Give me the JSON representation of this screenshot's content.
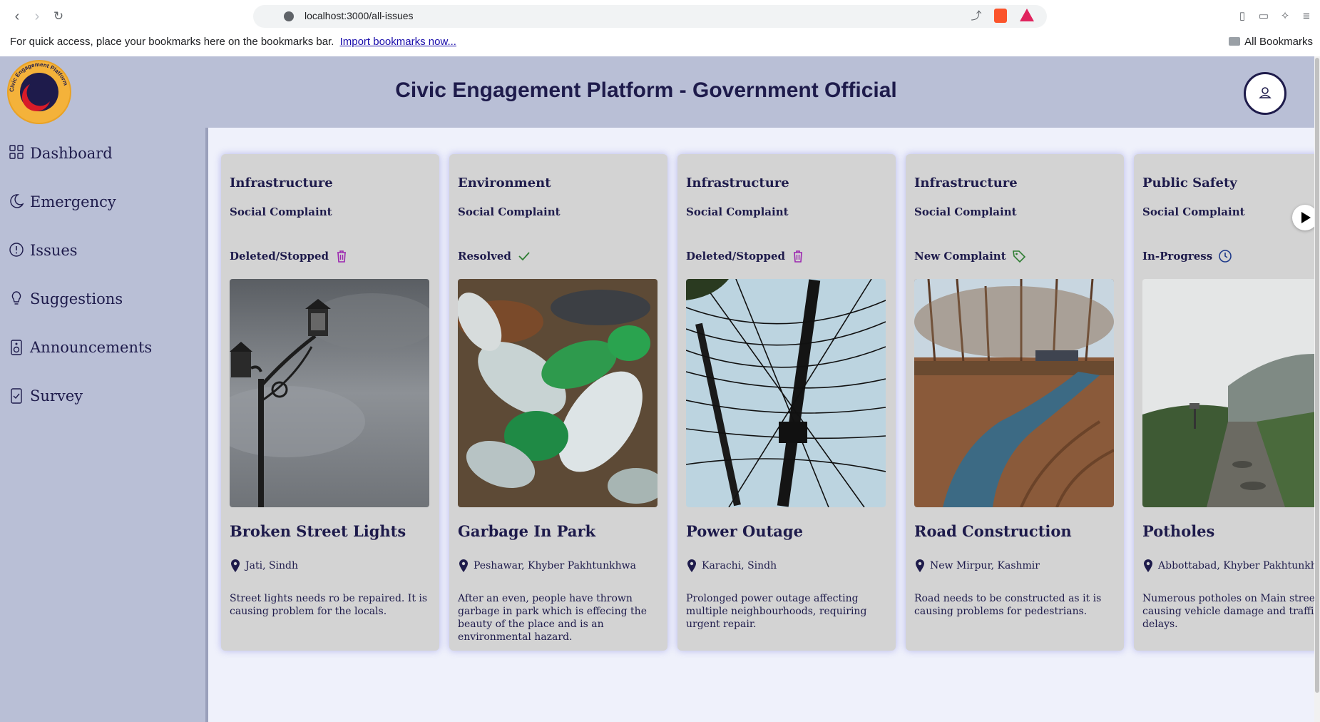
{
  "browser": {
    "url": "localhost:3000/all-issues",
    "bookmarks_prompt": "For quick access, place your bookmarks here on the bookmarks bar.",
    "import_link": "Import bookmarks now...",
    "all_bookmarks": "All Bookmarks"
  },
  "header": {
    "logo_text": "Civic Engagement Platform",
    "title": "Civic Engagement Platform - Government Official"
  },
  "sidebar": {
    "items": [
      {
        "label": "Dashboard",
        "icon": "grid-icon"
      },
      {
        "label": "Emergency",
        "icon": "moon-icon"
      },
      {
        "label": "Issues",
        "icon": "alert-circle-icon"
      },
      {
        "label": "Suggestions",
        "icon": "bulb-icon"
      },
      {
        "label": "Announcements",
        "icon": "speaker-icon"
      },
      {
        "label": "Survey",
        "icon": "clipboard-check-icon"
      }
    ]
  },
  "cards": [
    {
      "category": "Infrastructure",
      "type": "Social Complaint",
      "status": "Deleted/Stopped",
      "status_icon": "trash-icon",
      "title": "Broken Street Lights",
      "location": "Jati, Sindh",
      "description": "Street lights needs ro be repaired. It is causing problem for the locals."
    },
    {
      "category": "Environment",
      "type": "Social Complaint",
      "status": "Resolved",
      "status_icon": "check-icon",
      "title": "Garbage In Park",
      "location": "Peshawar, Khyber Pakhtunkhwa",
      "description": "After an even, people have thrown garbage in park which is effecing the beauty of the place and is an environmental hazard."
    },
    {
      "category": "Infrastructure",
      "type": "Social Complaint",
      "status": "Deleted/Stopped",
      "status_icon": "trash-icon",
      "title": "Power Outage",
      "location": "Karachi, Sindh",
      "description": "Prolonged power outage affecting multiple neighbourhoods, requiring urgent repair."
    },
    {
      "category": "Infrastructure",
      "type": "Social Complaint",
      "status": "New Complaint",
      "status_icon": "tag-icon",
      "title": "Road Construction",
      "location": "New Mirpur, Kashmir",
      "description": "Road needs to be constructed as it is causing problems for pedestrians."
    },
    {
      "category": "Public Safety",
      "type": "Social Complaint",
      "status": "In-Progress",
      "status_icon": "clock-icon",
      "title": "Potholes",
      "location": "Abbottabad, Khyber Pakhtunkhwa",
      "description": "Numerous potholes on Main street are causing vehicle damage and traffic delays."
    }
  ],
  "colors": {
    "header_bg": "#b9bfd6",
    "content_bg": "#eff1fb",
    "card_bg": "#d3d3d3",
    "text_primary": "#1e1b4b",
    "deleted": "#9c27b0",
    "resolved": "#2e7d32",
    "new": "#2e7d32",
    "in_progress": "#1e3a8a"
  }
}
